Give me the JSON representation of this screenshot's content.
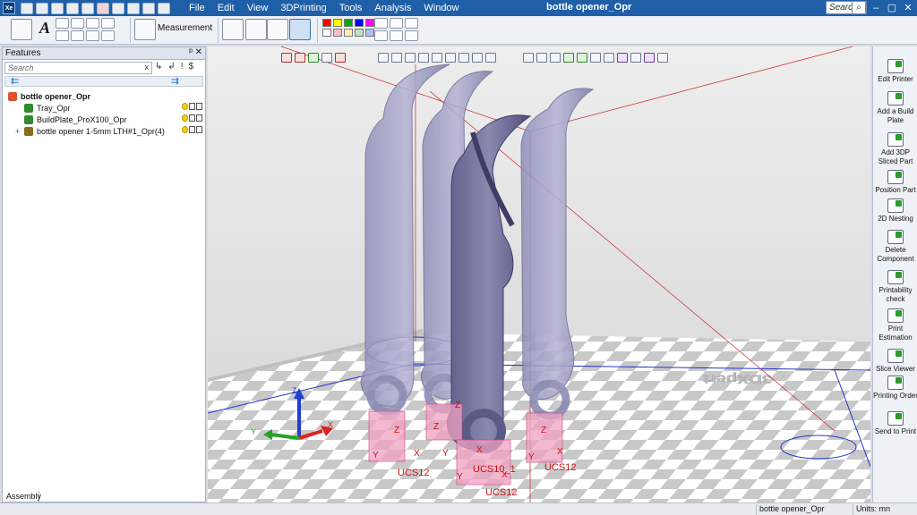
{
  "app": {
    "icon_label": "Xe",
    "menu": [
      "File",
      "Edit",
      "View",
      "3DPrinting",
      "Tools",
      "Analysis",
      "Window"
    ],
    "document_title": "bottle opener_Opr",
    "search_placeholder": "Search",
    "window_controls": [
      "‒",
      "▢",
      "✕"
    ]
  },
  "ribbon": {
    "measurement_label": "Measurement",
    "palette_colors": [
      "#ff0000",
      "#ffff00",
      "#00aa00",
      "#0000ff",
      "#ff00ff",
      "#ffffff",
      "#f4c0c0",
      "#fff0b0",
      "#c0e0c0",
      "#b0c0f0"
    ]
  },
  "features_panel": {
    "title": "Features",
    "header_controls": "ᵖ ✕",
    "search_placeholder": "Search",
    "search_clear": "x",
    "tools": [
      "↳",
      "↲",
      "!",
      "$"
    ],
    "tree": [
      {
        "label": "bottle opener_Opr",
        "level": 0,
        "bold": true,
        "icon_color": "#e0502a",
        "expander": ""
      },
      {
        "label": "Tray_Opr",
        "level": 1,
        "bold": false,
        "icon_color": "#2f8a2f",
        "expander": ""
      },
      {
        "label": "BuildPlate_ProX100_Opr",
        "level": 1,
        "bold": false,
        "icon_color": "#2f8a2f",
        "expander": ""
      },
      {
        "label": "bottle opener 1-5mm LTH#1_Opr(4)",
        "level": 1,
        "bold": false,
        "icon_color": "#8a6d1a",
        "expander": "+"
      }
    ],
    "bottom_tab": "Assembly"
  },
  "viewport": {
    "plate_text": "3DXpert",
    "triad_labels": {
      "x": "X",
      "y": "Y",
      "z": "Z"
    },
    "ucs_labels": [
      "UCS12",
      "UCS12",
      "UCS10_1",
      "UCS12"
    ],
    "axis_labels": [
      "Z",
      "Z",
      "Z",
      "Z",
      "Y",
      "X",
      "Y",
      "X",
      "Y",
      "X",
      "X",
      "Y"
    ]
  },
  "right_panel": {
    "items": [
      "Edit Printer",
      "Add a Build Plate",
      "Add 3DP Sliced Part",
      "Position Part",
      "2D Nesting",
      "Delete Component",
      "Printability check",
      "Print Estimation",
      "Slice Viewer",
      "Printing Order",
      "Send to Print"
    ]
  },
  "status_bar": {
    "document": "bottle opener_Opr",
    "units": "Units: mn"
  }
}
